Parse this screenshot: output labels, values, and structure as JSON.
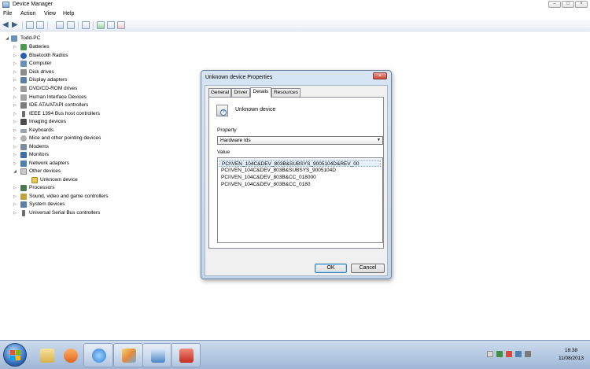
{
  "window": {
    "title": "Device Manager",
    "controls": {
      "minimize": "–",
      "maximize": "□",
      "close": "×"
    }
  },
  "menu": {
    "items": [
      "File",
      "Action",
      "View",
      "Help"
    ]
  },
  "tree": {
    "root": "Todd-PC",
    "items": [
      "Batteries",
      "Bluetooth Radios",
      "Computer",
      "Disk drives",
      "Display adapters",
      "DVD/CD-ROM drives",
      "Human Interface Devices",
      "IDE ATA/ATAPI controllers",
      "IEEE 1394 Bus host controllers",
      "Imaging devices",
      "Keyboards",
      "Mice and other pointing devices",
      "Modems",
      "Monitors",
      "Network adapters",
      "Other devices",
      "Unknown device",
      "Processors",
      "Sound, video and game controllers",
      "System devices",
      "Universal Serial Bus controllers"
    ]
  },
  "dialog": {
    "title": "Unknown device Properties",
    "close": "×",
    "tabs": [
      "General",
      "Driver",
      "Details",
      "Resources"
    ],
    "active_tab": "Details",
    "device_name": "Unknown device",
    "property_label": "Property",
    "property_value": "Hardware Ids",
    "value_label": "Value",
    "values": [
      "PCI\\VEN_104C&DEV_803B&SUBSYS_9005104D&REV_00",
      "PCI\\VEN_104C&DEV_803B&SUBSYS_9005104D",
      "PCI\\VEN_104C&DEV_803B&CC_018000",
      "PCI\\VEN_104C&DEV_803B&CC_0180"
    ],
    "ok_label": "OK",
    "cancel_label": "Cancel"
  },
  "taskbar": {
    "time": "18:38",
    "date": "11/08/2013"
  }
}
